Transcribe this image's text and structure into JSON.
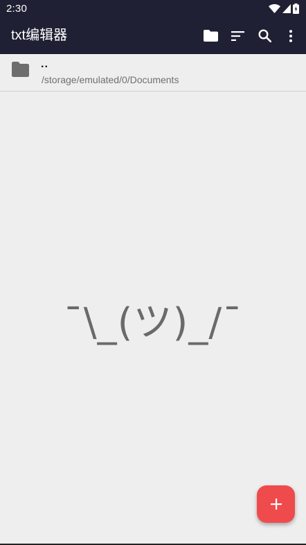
{
  "status_bar": {
    "time": "2:30",
    "icons": [
      "wifi-icon",
      "signal-icon",
      "battery-icon"
    ]
  },
  "app_bar": {
    "title": "txt编辑器",
    "actions": [
      "folder-icon",
      "sort-icon",
      "search-icon",
      "more-vert-icon"
    ],
    "background": "#1f2033"
  },
  "file_list": {
    "parent_entry": {
      "icon": "folder-icon",
      "name": "..",
      "path": "/storage/emulated/0/Documents"
    }
  },
  "empty_state": {
    "text": "¯\\_(ツ)_/¯"
  },
  "fab": {
    "icon": "plus-icon",
    "color": "#ef4b4c"
  }
}
